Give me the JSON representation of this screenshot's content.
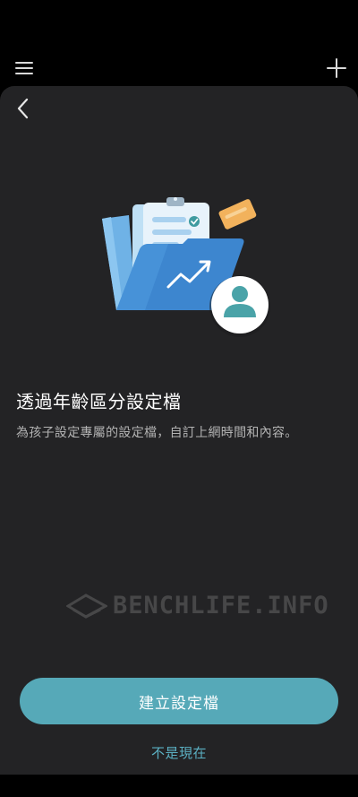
{
  "topbar": {
    "menu_icon": "hamburger-menu-icon",
    "add_icon": "plus-icon"
  },
  "sheet": {
    "back_icon": "chevron-left-icon",
    "illustration": "folder-profile-illustration",
    "title": "透過年齡區分設定檔",
    "description": "為孩子設定專屬的設定檔，自訂上網時間和內容。",
    "primary_button_label": "建立設定檔",
    "secondary_link_label": "不是現在",
    "watermark_text": "BENCHLIFE.INFO"
  },
  "colors": {
    "background": "#000000",
    "sheet": "#232325",
    "accent": "#56a9b8",
    "link": "#5bb0c3",
    "title_text": "#ffffff",
    "body_text": "#b3b3b3"
  }
}
